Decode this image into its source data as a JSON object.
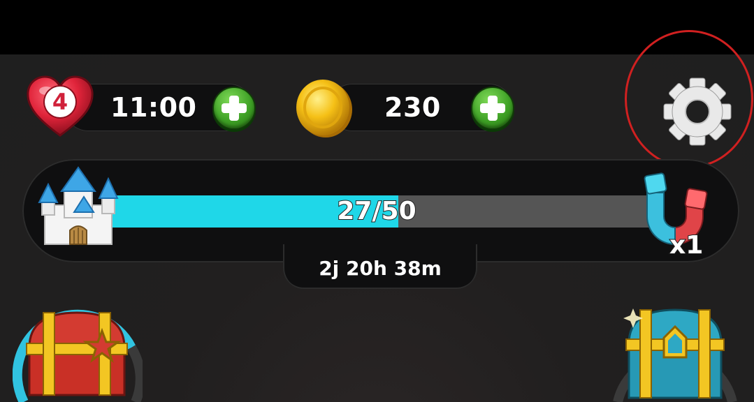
{
  "hud": {
    "lives": {
      "count": "4",
      "timer": "11:00"
    },
    "coins": {
      "amount": "230"
    }
  },
  "progress": {
    "current": 27,
    "max": 50,
    "label": "27/50",
    "time_left": "2j 20h 38m",
    "magnet_multiplier": "x1"
  },
  "colors": {
    "progress_fill": "#1fd7e8",
    "plus_button": "#3fa126",
    "heart": "#e0243a",
    "coin": "#f5c016",
    "highlight_circle": "#d02020"
  },
  "icons": {
    "heart": "heart-icon",
    "coin": "coin-icon",
    "plus": "plus-icon",
    "settings": "gear-icon",
    "castle": "castle-icon",
    "magnet": "magnet-icon",
    "red_chest": "treasure-chest-icon",
    "blue_chest": "treasure-chest-icon"
  }
}
